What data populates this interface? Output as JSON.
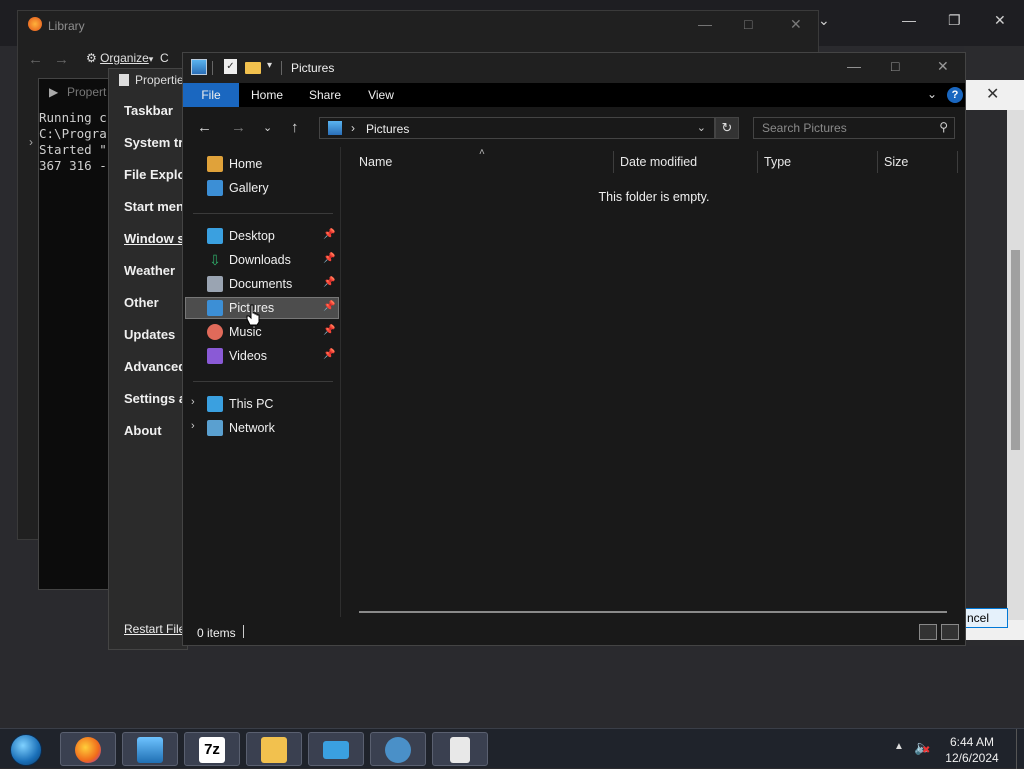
{
  "background_window": {
    "library_title": "Library",
    "organize_label": "Organize",
    "organize_suffix": "C"
  },
  "console": {
    "title": "Propert",
    "lines": [
      "Running c",
      "C:\\Progra",
      "Started \"",
      "367 316 -"
    ]
  },
  "properties": {
    "title": "Propertie",
    "nav": [
      "Taskbar",
      "System tr",
      "File Explo",
      "Start men",
      "Window s",
      "Weather",
      "Other",
      "Updates",
      "Advanced",
      "Settings a",
      "About"
    ],
    "restart_link": "Restart File"
  },
  "dialog_right": {
    "cancel_label": "ncel"
  },
  "explorer": {
    "title": "Pictures",
    "ribbon_tabs": [
      "File",
      "Home",
      "Share",
      "View"
    ],
    "address": {
      "crumb": "Pictures"
    },
    "search_placeholder": "Search Pictures",
    "nav_items": [
      {
        "label": "Home",
        "icon": "home-icon",
        "color": "#e0a23a"
      },
      {
        "label": "Gallery",
        "icon": "gallery-icon",
        "color": "#3c8fd6"
      },
      {
        "label": "Desktop",
        "icon": "desktop-icon",
        "color": "#3aa0e0",
        "pinned": true
      },
      {
        "label": "Downloads",
        "icon": "download-icon",
        "color": "#2fae6a",
        "pinned": true
      },
      {
        "label": "Documents",
        "icon": "documents-icon",
        "color": "#9aa4b2",
        "pinned": true
      },
      {
        "label": "Pictures",
        "icon": "pictures-icon",
        "color": "#3c8fd6",
        "pinned": true,
        "selected": true
      },
      {
        "label": "Music",
        "icon": "music-icon",
        "color": "#e06a5a",
        "pinned": true
      },
      {
        "label": "Videos",
        "icon": "videos-icon",
        "color": "#8a5ad6",
        "pinned": true
      },
      {
        "label": "This PC",
        "icon": "computer-icon",
        "color": "#3aa0e0"
      },
      {
        "label": "Network",
        "icon": "network-icon",
        "color": "#5aa0d0"
      }
    ],
    "columns": [
      "Name",
      "Date modified",
      "Type",
      "Size"
    ],
    "empty_message": "This folder is empty.",
    "status": "0 items"
  },
  "taskbar": {
    "apps": [
      "firefox-icon",
      "photos-icon",
      "7zip-icon",
      "file-explorer-icon",
      "remote-desktop-icon",
      "media-icon",
      "properties-icon"
    ],
    "app_label_7zip": "7z",
    "time": "6:44 AM",
    "date": "12/6/2024"
  },
  "accent_colors": {
    "file_tab": "#1a67c0",
    "selection": "#4d4d4d"
  }
}
